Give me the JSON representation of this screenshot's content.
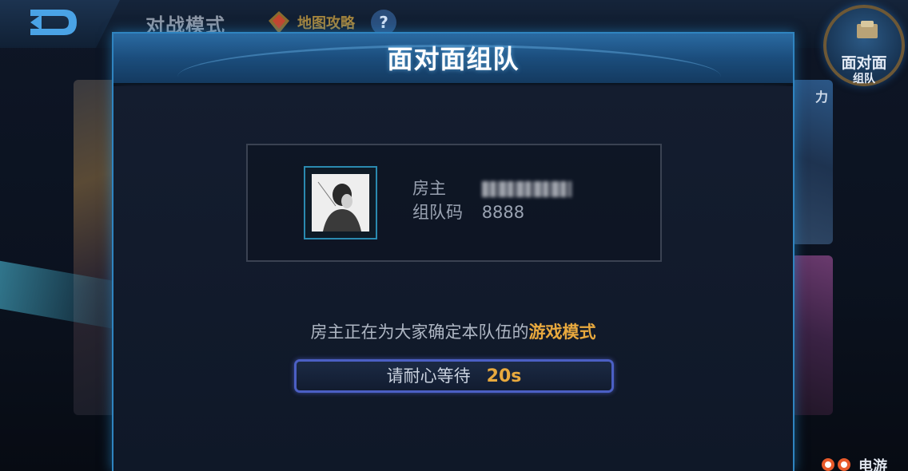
{
  "header": {
    "mode_title": "对战模式",
    "map_guide_label": "地图攻略",
    "help_label": "?"
  },
  "side_cards": {
    "right_top_label": "力"
  },
  "team_badge": {
    "line1": "面对面",
    "line2": "组队",
    "icon": "card-icon"
  },
  "modal": {
    "title": "面对面组队",
    "host": {
      "host_label": "房主",
      "team_code_label": "组队码",
      "team_code": "8888",
      "avatar_icon": "avatar-portrait"
    },
    "status": {
      "prefix": "房主正在为大家确定本队伍的",
      "highlight": "游戏模式"
    },
    "wait_button": {
      "label": "请耐心等待",
      "seconds": "20s"
    }
  },
  "watermark": {
    "text": "电游"
  },
  "colors": {
    "accent_blue": "#2f84c0",
    "highlight_gold": "#e8a93e",
    "button_border": "#4b5fc4"
  }
}
